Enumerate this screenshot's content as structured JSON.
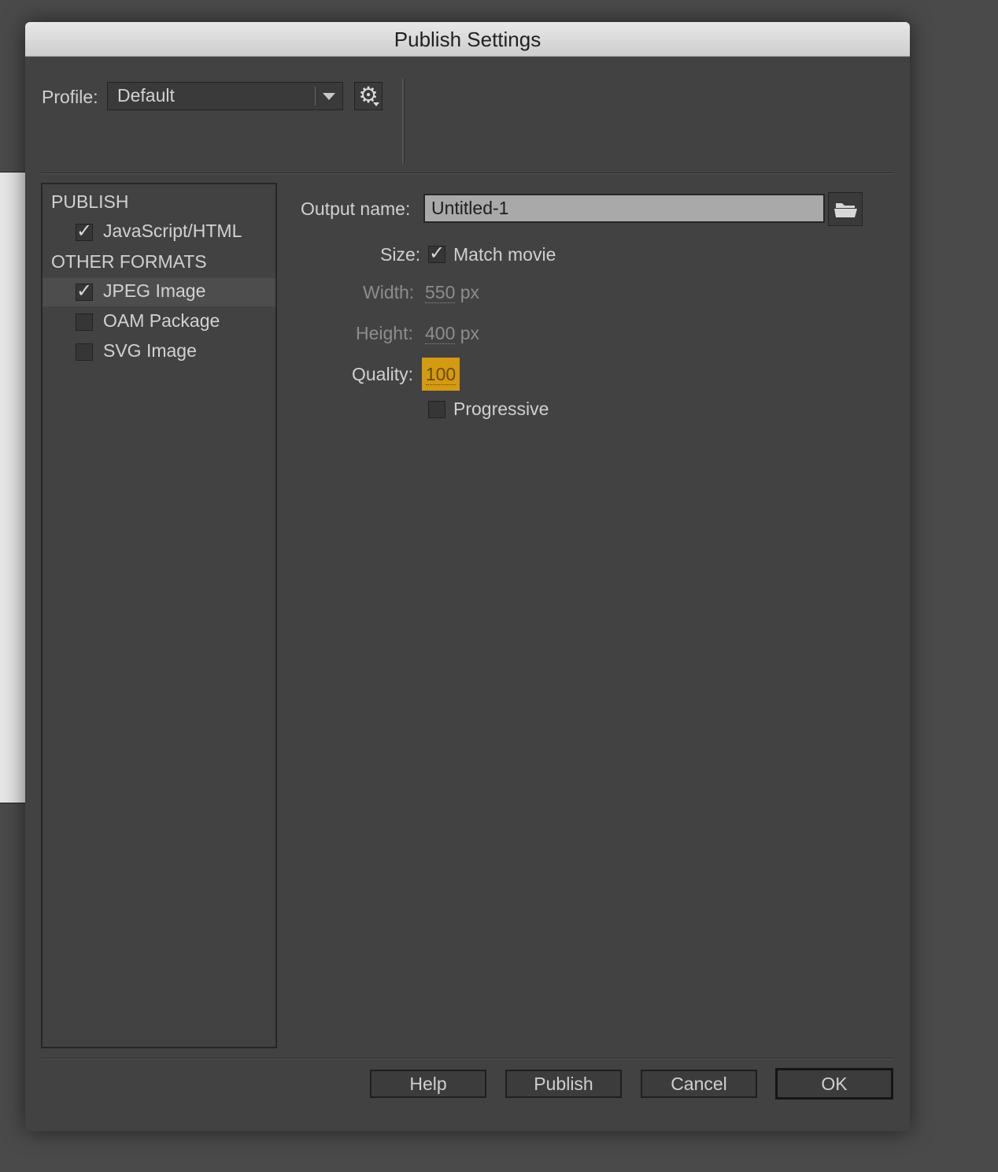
{
  "dialog": {
    "title": "Publish Settings"
  },
  "profile": {
    "label": "Profile:",
    "value": "Default"
  },
  "left_panel": {
    "publish_heading": "PUBLISH",
    "publish_items": [
      {
        "label": "JavaScript/HTML",
        "checked": true
      }
    ],
    "other_heading": "OTHER FORMATS",
    "other_items": [
      {
        "label": "JPEG Image",
        "checked": true,
        "selected": true
      },
      {
        "label": "OAM Package",
        "checked": false
      },
      {
        "label": "SVG Image",
        "checked": false
      }
    ]
  },
  "settings": {
    "output_name_label": "Output name:",
    "output_name_value": "Untitled-1",
    "size_label": "Size:",
    "match_movie_label": "Match movie",
    "match_movie_checked": true,
    "width_label": "Width:",
    "width_value": "550",
    "width_unit": "px",
    "height_label": "Height:",
    "height_value": "400",
    "height_unit": "px",
    "quality_label": "Quality:",
    "quality_value": "100",
    "progressive_label": "Progressive",
    "progressive_checked": false
  },
  "buttons": {
    "help": "Help",
    "publish": "Publish",
    "cancel": "Cancel",
    "ok": "OK"
  },
  "icons": {
    "gear": "gear-icon",
    "folder": "folder-icon",
    "dropdown": "chevron-down-icon",
    "check": "checkmark-icon"
  },
  "colors": {
    "quality_highlight": "#d49a10",
    "dialog_bg": "#424242"
  }
}
